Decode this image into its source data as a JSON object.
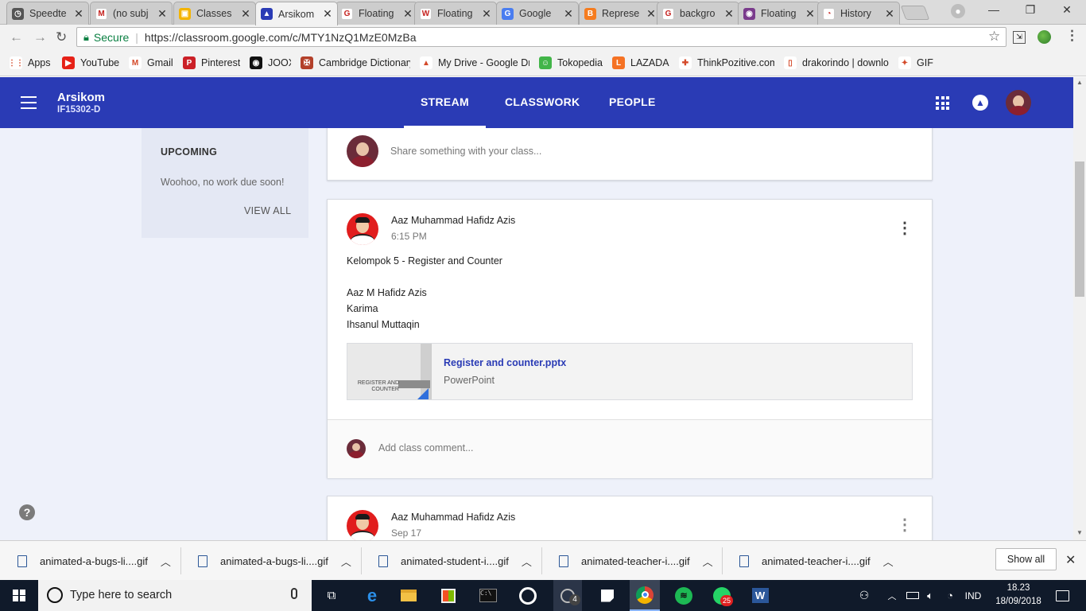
{
  "browser": {
    "tabs": [
      {
        "title": "Speedte",
        "fav_color": "#555555",
        "fav_glyph": "◷",
        "icon": "speedtest-icon"
      },
      {
        "title": "(no subj",
        "fav_color": "#ffffff",
        "fav_glyph": "M",
        "icon": "gmail-icon"
      },
      {
        "title": "Classes",
        "fav_color": "#f4b400",
        "fav_glyph": "▣",
        "icon": "classroom-icon"
      },
      {
        "title": "Arsikom",
        "fav_color": "#2a3bb5",
        "fav_glyph": "▲",
        "icon": "classroom-people-icon",
        "active": true
      },
      {
        "title": "Floating",
        "fav_color": "#ffffff",
        "fav_glyph": "G",
        "icon": "google-icon"
      },
      {
        "title": "Floating",
        "fav_color": "#ffffff",
        "fav_glyph": "W",
        "icon": "wikipedia-icon"
      },
      {
        "title": "Google",
        "fav_color": "#4a7df0",
        "fav_glyph": "G",
        "icon": "google-translate-icon"
      },
      {
        "title": "Represe",
        "fav_color": "#f57c1f",
        "fav_glyph": "B",
        "icon": "blogger-icon"
      },
      {
        "title": "backgro",
        "fav_color": "#ffffff",
        "fav_glyph": "G",
        "icon": "google-icon"
      },
      {
        "title": "Floating",
        "fav_color": "#7a3b8c",
        "fav_glyph": "◉",
        "icon": "site-icon"
      },
      {
        "title": "History",
        "fav_color": "#ffffff",
        "fav_glyph": "◔",
        "icon": "history-icon"
      }
    ],
    "secure_label": "Secure",
    "url": "https://classroom.google.com/c/MTY1NzQ1MzE0MzBa",
    "bookmarks": [
      {
        "label": "Apps",
        "color": "#ffffff",
        "glyph": "⋮⋮",
        "icon": "apps-grid-icon"
      },
      {
        "label": "YouTube",
        "color": "#e62117",
        "glyph": "▶",
        "icon": "youtube-icon"
      },
      {
        "label": "Gmail",
        "color": "#ffffff",
        "glyph": "M",
        "icon": "gmail-icon"
      },
      {
        "label": "Pinterest",
        "color": "#cb2027",
        "glyph": "P",
        "icon": "pinterest-icon"
      },
      {
        "label": "JOOX",
        "color": "#111111",
        "glyph": "◉",
        "icon": "joox-icon"
      },
      {
        "label": "Cambridge Dictionary",
        "color": "#b3402a",
        "glyph": "✠",
        "icon": "cambridge-icon"
      },
      {
        "label": "My Drive - Google Drive",
        "color": "#ffffff",
        "glyph": "▲",
        "icon": "google-drive-icon"
      },
      {
        "label": "Tokopedia",
        "color": "#42b549",
        "glyph": "☺",
        "icon": "tokopedia-icon"
      },
      {
        "label": "LAZADA",
        "color": "#f57224",
        "glyph": "L",
        "icon": "lazada-icon"
      },
      {
        "label": "ThinkPozitive.com",
        "color": "#ffffff",
        "glyph": "✚",
        "icon": "thinkpozitive-icon"
      },
      {
        "label": "drakorindo | download",
        "color": "#ffffff",
        "glyph": "▯",
        "icon": "page-icon"
      },
      {
        "label": "GIF",
        "color": "#ffffff",
        "glyph": "✦",
        "icon": "gif-icon"
      }
    ]
  },
  "classroom": {
    "class_name": "Arsikom",
    "class_code": "IF15302-D",
    "nav": {
      "stream": "STREAM",
      "classwork": "CLASSWORK",
      "people": "PEOPLE"
    },
    "upcoming": {
      "title": "UPCOMING",
      "empty": "Woohoo, no work due soon!",
      "view_all": "VIEW ALL"
    },
    "share_placeholder": "Share something with your class...",
    "posts": [
      {
        "author": "Aaz Muhammad Hafidz Azis",
        "time": "6:15 PM",
        "lines": [
          "Kelompok 5 - Register and Counter",
          "",
          "Aaz M Hafidz Azis",
          "Karima",
          "Ihsanul Muttaqin"
        ],
        "attachment": {
          "name": "Register and counter.pptx",
          "type": "PowerPoint",
          "thumb_text": "REGISTER AND COUNTER"
        },
        "comment_placeholder": "Add class comment..."
      },
      {
        "author": "Aaz Muhammad Hafidz Azis",
        "time": "Sep 17"
      }
    ],
    "help_glyph": "?"
  },
  "downloads": {
    "items": [
      "animated-a-bugs-li....gif",
      "animated-a-bugs-li....gif",
      "animated-student-i....gif",
      "animated-teacher-i....gif",
      "animated-teacher-i....gif"
    ],
    "show_all": "Show all"
  },
  "taskbar": {
    "search_placeholder": "Type here to search",
    "language": "IND",
    "time": "18.23",
    "date": "18/09/2018",
    "badge_photos": "4",
    "badge_whatsapp": "25"
  }
}
